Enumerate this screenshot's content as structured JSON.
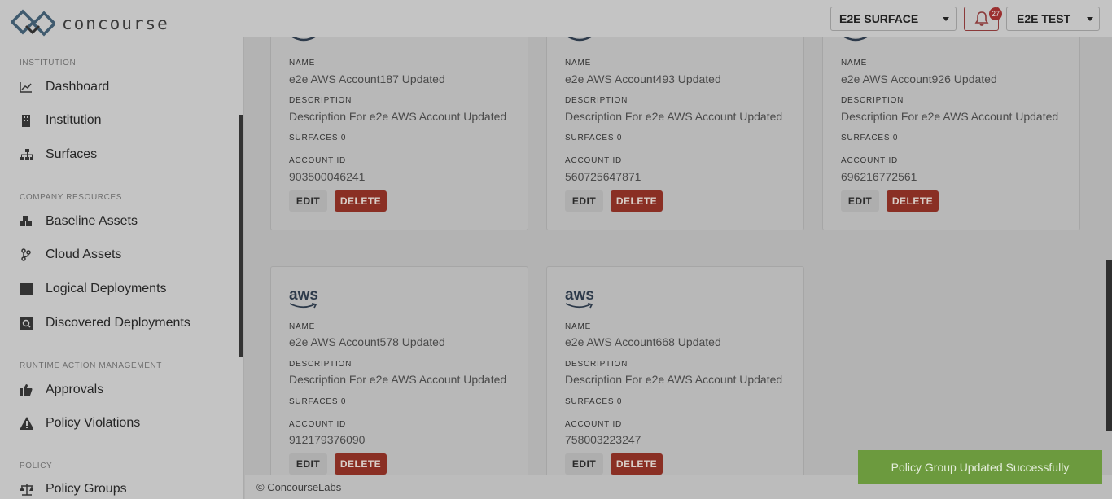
{
  "brand": {
    "name": "concourse"
  },
  "header": {
    "surface_select": "E2E SURFACE",
    "notification_count": "27",
    "user_menu": "E2E TEST"
  },
  "sidebar": {
    "sections": [
      {
        "title": "INSTITUTION",
        "items": [
          "Dashboard",
          "Institution",
          "Surfaces"
        ]
      },
      {
        "title": "COMPANY RESOURCES",
        "items": [
          "Baseline Assets",
          "Cloud Assets",
          "Logical Deployments",
          "Discovered Deployments"
        ]
      },
      {
        "title": "RUNTIME ACTION MANAGEMENT",
        "items": [
          "Approvals",
          "Policy Violations"
        ]
      },
      {
        "title": "POLICY",
        "items": [
          "Policy Groups"
        ]
      }
    ]
  },
  "labels": {
    "name": "NAME",
    "description": "DESCRIPTION",
    "account_id": "ACCOUNT ID",
    "edit": "EDIT",
    "delete": "DELETE",
    "provider_logo": "aws"
  },
  "cards": [
    {
      "name": "e2e AWS Account187 Updated",
      "description": "Description For e2e AWS Account Updated",
      "surfaces": "SURFACES 0",
      "account_id": "903500046241"
    },
    {
      "name": "e2e AWS Account493 Updated",
      "description": "Description For e2e AWS Account Updated",
      "surfaces": "SURFACES 0",
      "account_id": "560725647871"
    },
    {
      "name": "e2e AWS Account926 Updated",
      "description": "Description For e2e AWS Account Updated",
      "surfaces": "SURFACES 0",
      "account_id": "696216772561"
    },
    {
      "name": "e2e AWS Account578 Updated",
      "description": "Description For e2e AWS Account Updated",
      "surfaces": "SURFACES 0",
      "account_id": "912179376090"
    },
    {
      "name": "e2e AWS Account668 Updated",
      "description": "Description For e2e AWS Account Updated",
      "surfaces": "SURFACES 0",
      "account_id": "758003223247"
    }
  ],
  "footer": {
    "copyright": "© ConcourseLabs"
  },
  "toast": {
    "message": "Policy Group Updated Successfully"
  }
}
